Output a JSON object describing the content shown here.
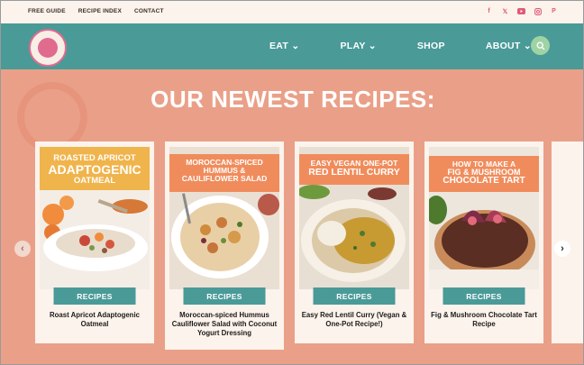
{
  "topbar": {
    "links": [
      "FREE GUIDE",
      "RECIPE INDEX",
      "CONTACT"
    ]
  },
  "social_icons": [
    "facebook-icon",
    "x-icon",
    "youtube-icon",
    "instagram-icon",
    "pinterest-icon"
  ],
  "nav": {
    "items": [
      "EAT",
      "PLAY",
      "SHOP",
      "ABOUT"
    ]
  },
  "heading": "OUR NEWEST RECIPES:",
  "cards": [
    {
      "banner_line1": "ROASTED APRICOT",
      "banner_line2": "ADAPTOGENIC",
      "banner_line3": "OATMEAL",
      "button": "RECIPES",
      "title": "Roast Apricot Adaptogenic Oatmeal"
    },
    {
      "banner_line1": "MOROCCAN-SPICED",
      "banner_line2": "HUMMUS &",
      "banner_line3": "CAULIFLOWER SALAD",
      "button": "RECIPES",
      "title": "Moroccan-spiced Hummus Cauliflower Salad with Coconut Yogurt Dressing"
    },
    {
      "banner_line1": "EASY VEGAN ONE-POT",
      "banner_line2": "RED LENTIL CURRY",
      "banner_line3": "",
      "button": "RECIPES",
      "title": "Easy Red Lentil Curry (Vegan & One-Pot Recipe!)"
    },
    {
      "banner_line1": "HOW TO MAKE A",
      "banner_line2": "FIG & MUSHROOM",
      "banner_line3": "CHOCOLATE TART",
      "button": "RECIPES",
      "title": "Fig & Mushroom Chocolate Tart Recipe"
    }
  ],
  "colors": {
    "teal": "#4a9a98",
    "salmon": "#eaa088",
    "cream": "#fbf3ec",
    "pink": "#e06b8f",
    "banner_orange": "#f08c5c",
    "banner_yellow": "#f0b44c"
  }
}
